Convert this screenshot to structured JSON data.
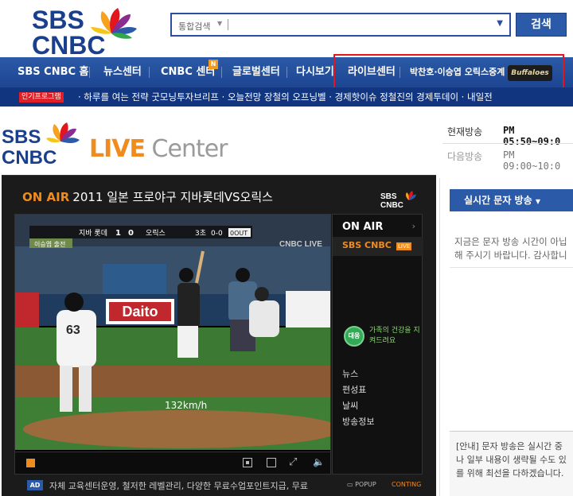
{
  "header": {
    "logo_top": "SBS",
    "logo_bottom": "CNBC",
    "search": {
      "scope": "통합검색",
      "value": ""
    },
    "search_button": "검색"
  },
  "nav": {
    "items": [
      "SBS CNBC 홈",
      "뉴스센터",
      "CNBC 센터",
      "글로벌센터",
      "다시보기",
      "라이브센터",
      "박찬호·이승엽 오릭스중계"
    ],
    "badge": "N",
    "buffaloes": "Buffaloes"
  },
  "ticker": {
    "badge": "인기프로그램",
    "text": "· 하루를 여는 전략 굿모닝투자브리프   · 오늘전망 장철의 오프닝벨   · 경제핫이슈 정철진의 경제투데이   · 내일전"
  },
  "live_center": {
    "logo_top": "SBS",
    "logo_bottom": "CNBC",
    "live": "LIVE",
    "center": "Center"
  },
  "schedule": {
    "now_label": "현재방송",
    "now_time": "PM 05:50~09:0",
    "next_label": "다음방송",
    "next_time": "PM 09:00~10:0"
  },
  "player": {
    "onair_tag": "ON AIR",
    "title": "2011 일본 프로야구 지바롯데VS오릭스",
    "panel_logo_top": "SBS",
    "panel_logo_bottom": "CNBC",
    "scoreboard": {
      "team1": "지바 롯데",
      "score1": "1",
      "score2": "0",
      "team2": "오릭스",
      "inning": "3초",
      "count": "0-0",
      "outs": "0OUT",
      "sub": "이승엽 출전"
    },
    "speed": "132km/h",
    "ad_board": "Daito",
    "player_number": "63",
    "watermark": "CNBC LIVE"
  },
  "side": {
    "onair": "ON AIR",
    "channel": "SBS CNBC",
    "live": "LIVE",
    "ad_circle": "대웅",
    "ad_text": "가족의 건강을 지켜드려요",
    "links": [
      "뉴스",
      "편성표",
      "날씨",
      "방송정보"
    ]
  },
  "ad_strip": {
    "tag": "AD",
    "text": "자체 교육센터운영, 철저한 레벨관리, 다양한 무료수업포인트지급, 무료",
    "popup": "POPUP",
    "conting": "CONTING"
  },
  "text_broadcast": {
    "tab": "실시간 문자 방송",
    "msg_line1": "지금은 문자 방송 시간이 아닙",
    "msg_line2": "해 주시기 바랍니다. 감사합니",
    "notice_line1": "[안내] 문자 방송은 실시간 중",
    "notice_line2": "나 일부 내용이 생략될 수도 있",
    "notice_line3": "를 위해 최선을 다하겠습니다."
  }
}
